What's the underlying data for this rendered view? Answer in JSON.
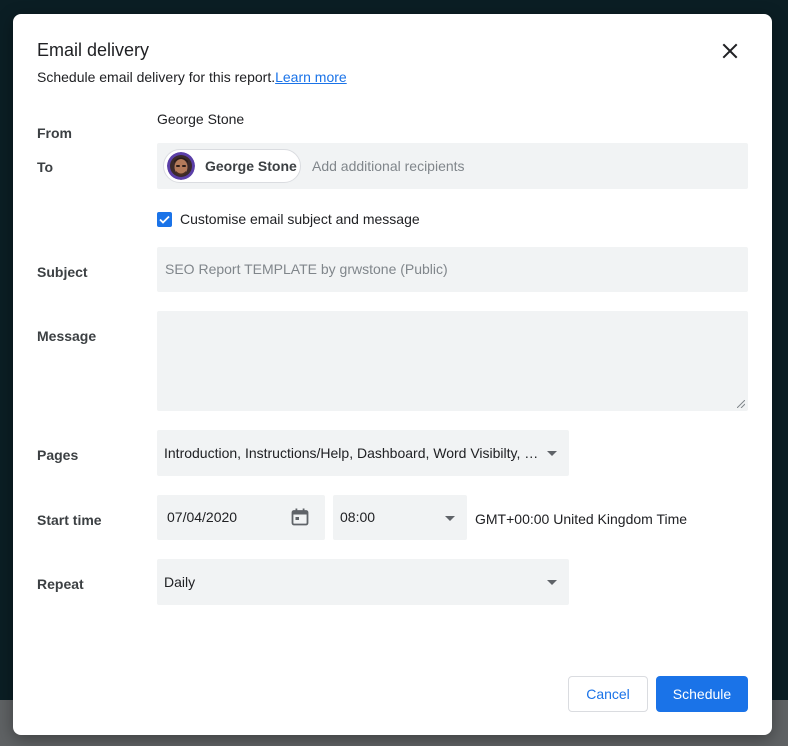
{
  "dialog": {
    "title": "Email delivery",
    "subtitle": "Schedule email delivery for this report.",
    "learn_more": "Learn more"
  },
  "form": {
    "from_label": "From",
    "from_value": "George Stone",
    "to_label": "To",
    "to_chip": "George Stone",
    "to_placeholder": "Add additional recipients",
    "customise_label": "Customise email subject and message",
    "customise_checked": true,
    "subject_label": "Subject",
    "subject_value": "SEO Report TEMPLATE by grwstone (Public)",
    "message_label": "Message",
    "message_value": "",
    "pages_label": "Pages",
    "pages_value": "Introduction, Instructions/Help, Dashboard, Word Visibilty, Page Visibility",
    "start_time_label": "Start time",
    "start_date": "07/04/2020",
    "start_time": "08:00",
    "timezone": "GMT+00:00 United Kingdom Time",
    "repeat_label": "Repeat",
    "repeat_value": "Daily"
  },
  "actions": {
    "cancel": "Cancel",
    "schedule": "Schedule"
  },
  "icons": {
    "close": "close-icon",
    "check": "check-icon",
    "calendar": "calendar-icon",
    "dropdown": "chevron-down-icon",
    "avatar": "avatar"
  },
  "colors": {
    "accent": "#1a73e8",
    "field_bg": "#f1f3f4",
    "backdrop": "#0b1e24"
  }
}
